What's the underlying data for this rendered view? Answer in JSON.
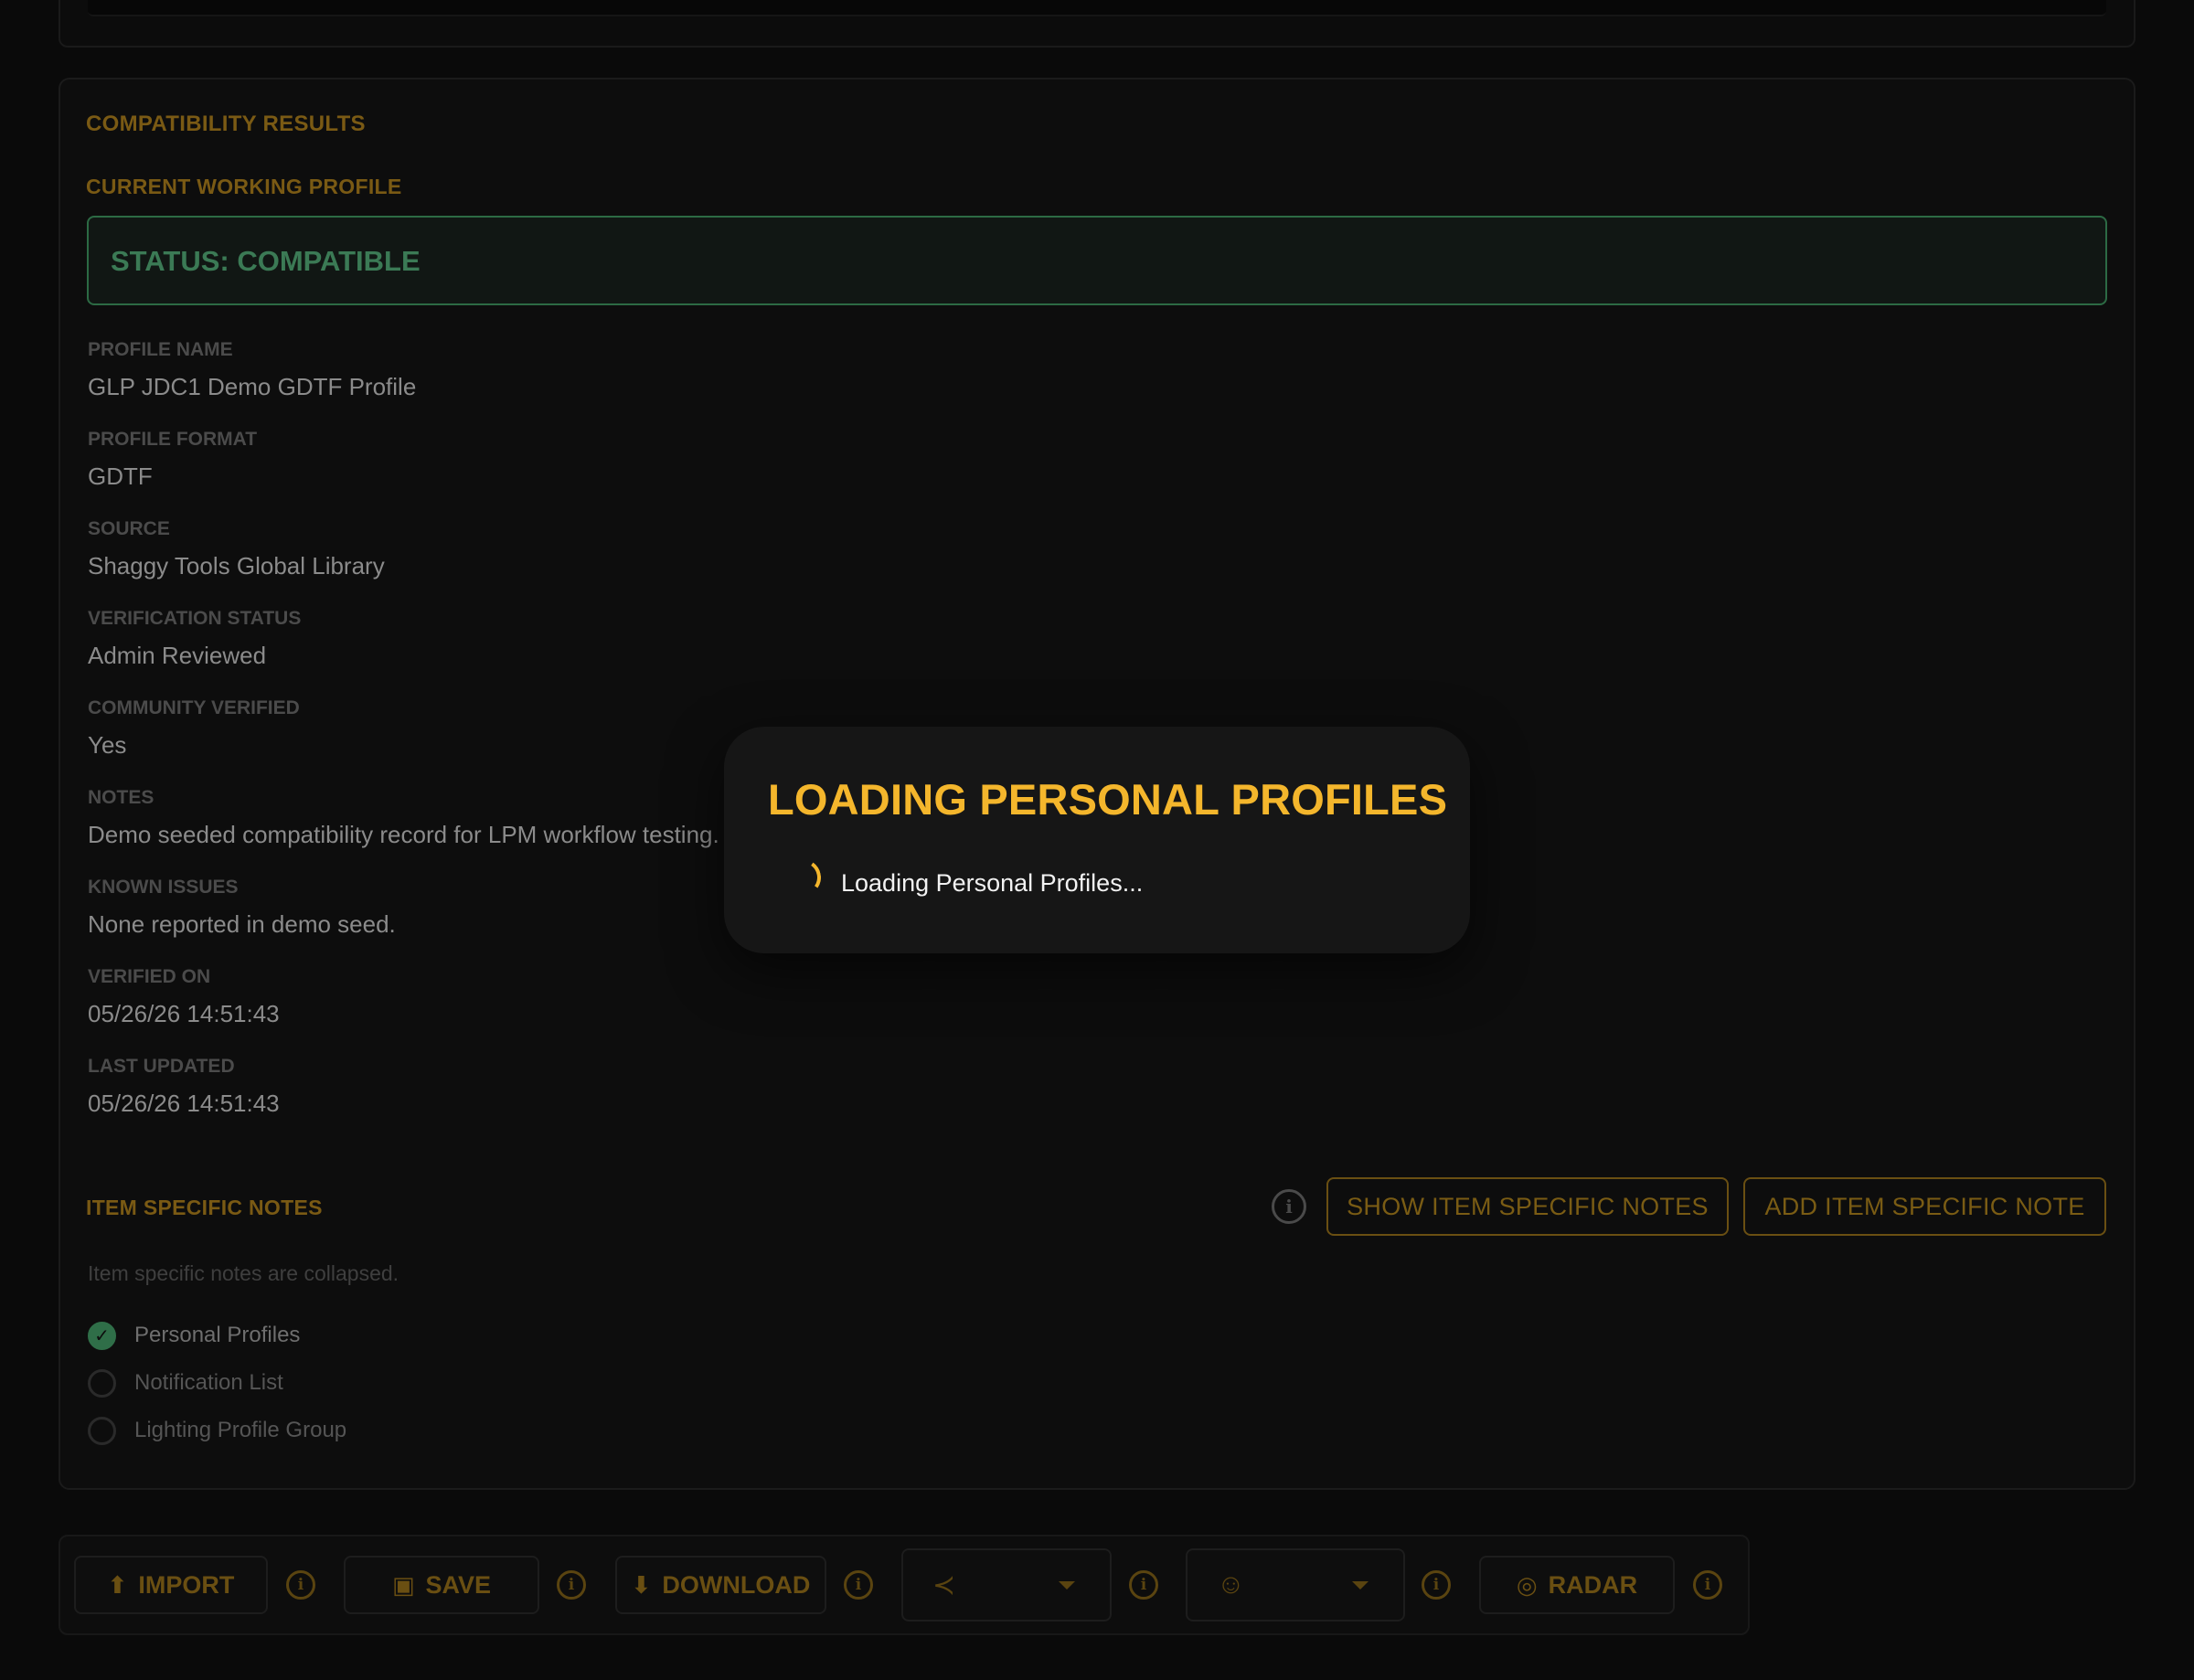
{
  "compat": {
    "section_title": "COMPATIBILITY RESULTS",
    "profile_heading": "CURRENT WORKING PROFILE",
    "status": "STATUS: COMPATIBLE",
    "fields": {
      "profile_name_label": "PROFILE NAME",
      "profile_name": "GLP JDC1 Demo GDTF Profile",
      "profile_format_label": "PROFILE FORMAT",
      "profile_format": "GDTF",
      "source_label": "SOURCE",
      "source": "Shaggy Tools Global Library",
      "verification_label": "VERIFICATION STATUS",
      "verification": "Admin Reviewed",
      "community_label": "COMMUNITY VERIFIED",
      "community": "Yes",
      "notes_label": "NOTES",
      "notes": "Demo seeded compatibility record for LPM workflow testing.",
      "issues_label": "KNOWN ISSUES",
      "issues": "None reported in demo seed.",
      "verified_label": "VERIFIED ON",
      "verified": "05/26/26 14:51:43",
      "updated_label": "LAST UPDATED",
      "updated": "05/26/26 14:51:43"
    }
  },
  "item_notes": {
    "title": "ITEM SPECIFIC NOTES",
    "show_button": "SHOW ITEM SPECIFIC NOTES",
    "add_button": "ADD ITEM SPECIFIC NOTE",
    "collapsed_text": "Item specific notes are collapsed.",
    "options": [
      {
        "label": "Personal Profiles",
        "checked": true
      },
      {
        "label": "Notification List",
        "checked": false
      },
      {
        "label": "Lighting Profile Group",
        "checked": false
      }
    ]
  },
  "toolbar": {
    "import": "IMPORT",
    "save": "SAVE",
    "download": "DOWNLOAD",
    "radar": "RADAR",
    "icons": {
      "import": "upload-icon",
      "save": "floppy-icon",
      "download": "download-icon",
      "share": "share-icon",
      "user": "user-group-icon",
      "radar": "radar-icon",
      "info": "info-icon"
    }
  },
  "modal": {
    "title": "LOADING PERSONAL PROFILES",
    "message": "Loading Personal Profiles..."
  },
  "colors": {
    "accent": "#f4b62c",
    "accent_dim": "#7a5a14",
    "success": "#2f6e48",
    "background": "#0a0a0a"
  }
}
